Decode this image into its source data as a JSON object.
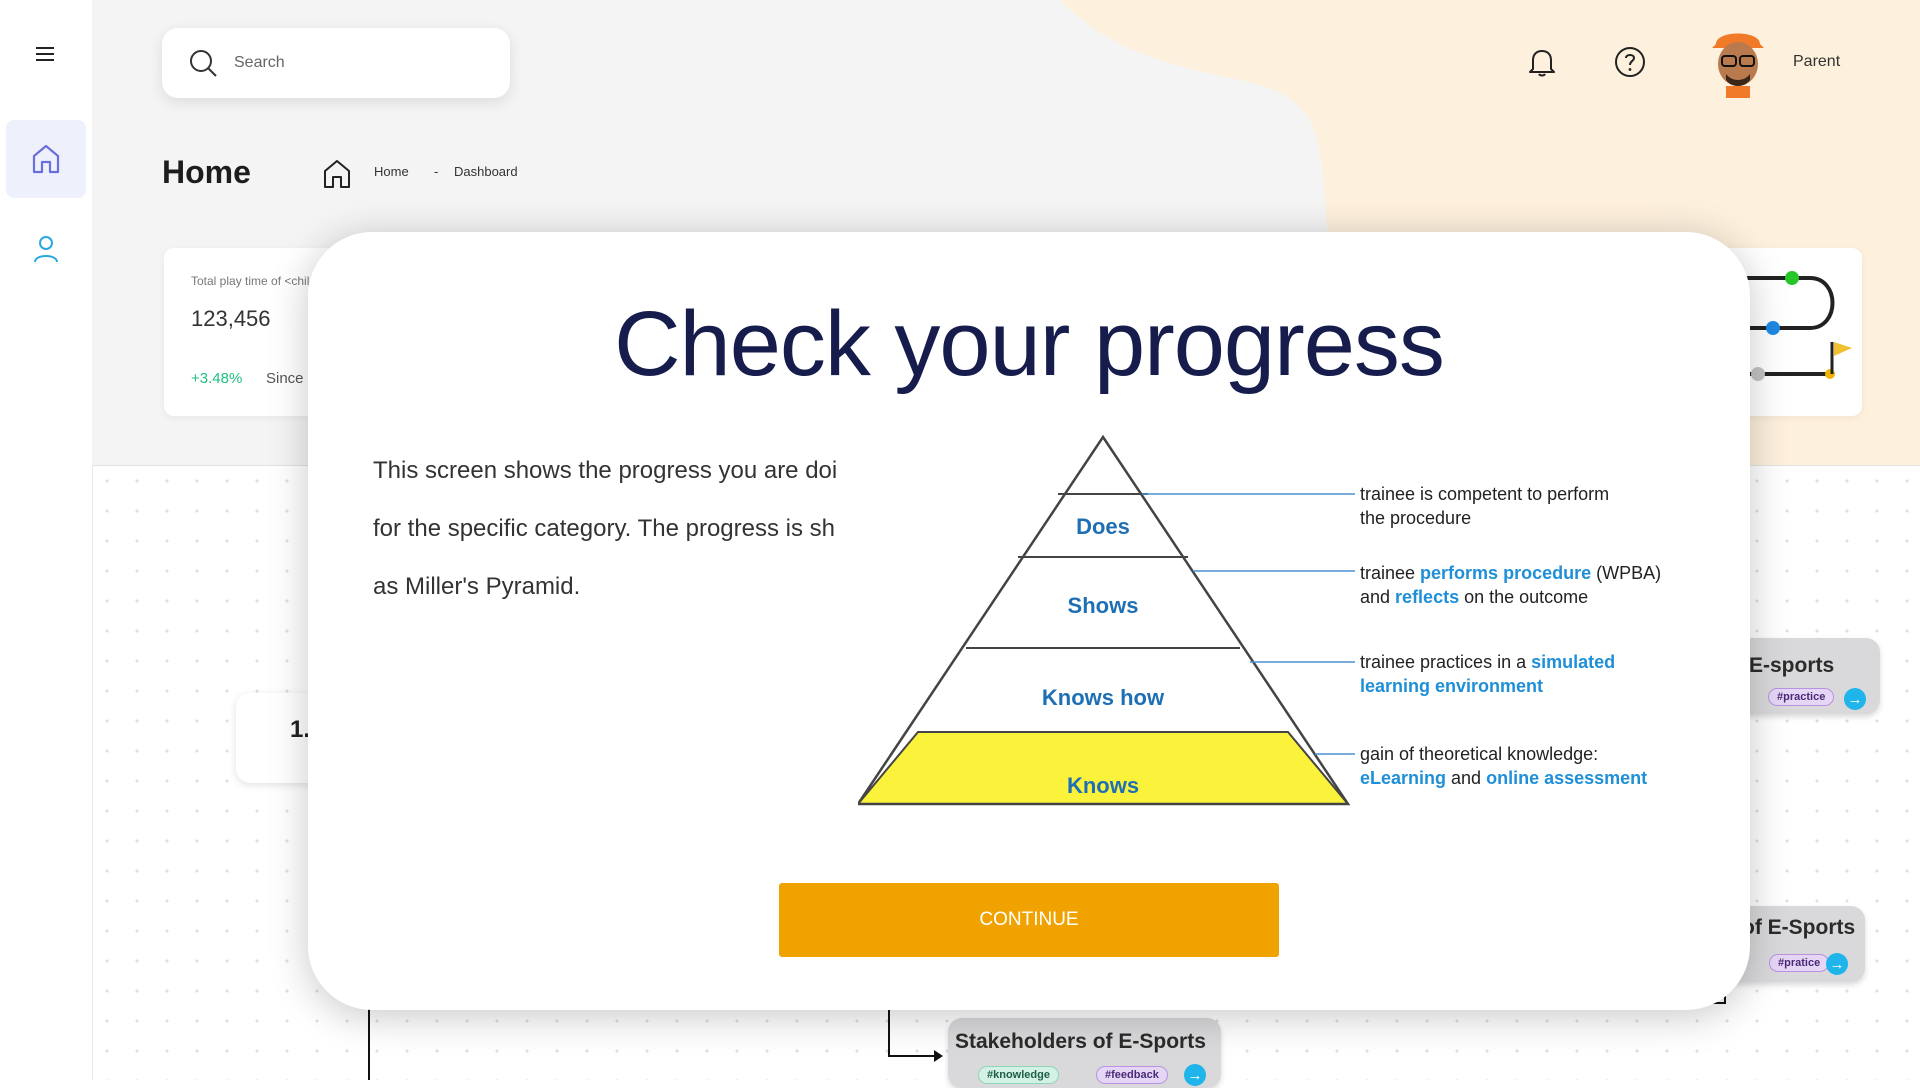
{
  "header": {
    "search_placeholder": "Search",
    "user_label": "Parent",
    "page_title": "Home",
    "breadcrumb": [
      "Home",
      "-",
      "Dashboard"
    ]
  },
  "stats": {
    "label": "Total play time of <child",
    "value": "123,456",
    "change": "+3.48%",
    "since": "Since"
  },
  "cards": {
    "step_number": "1.",
    "esports_title": "E-sports",
    "esports_tag": "#practice",
    "of_esports_title": "of E-Sports",
    "of_esports_tag": "#pratice",
    "stakeholders_title": "Stakeholders of E-Sports",
    "stakeholders_tags": [
      "#knowledge",
      "#feedback"
    ]
  },
  "modal": {
    "title": "Check your progress",
    "text_lines": [
      "This screen shows the progress you are doi",
      "for the specific category. The progress is sh",
      "as Miller's Pyramid."
    ],
    "continue_label": "CONTINUE",
    "pyramid": {
      "levels": [
        "Does",
        "Shows",
        "Knows how",
        "Knows"
      ],
      "descriptions": {
        "does": [
          "trainee is competent to perform",
          "the procedure"
        ],
        "shows": {
          "line1_prefix": "trainee ",
          "line1_highlight": "performs procedure",
          "line1_suffix": " (WPBA)",
          "line2_prefix": "and ",
          "line2_highlight": "reflects",
          "line2_suffix": " on the outcome"
        },
        "knows_how": {
          "line1_prefix": "trainee practices in a ",
          "line1_highlight": "simulated",
          "line2_highlight": "learning environment"
        },
        "knows": {
          "line1": "gain of theoretical knowledge:",
          "line2_highlight_a": "eLearning",
          "line2_mid": " and ",
          "line2_highlight_b": "online assessment"
        }
      },
      "colors": {
        "level_text": "#1f6fb5",
        "highlight": "#1f8fd8",
        "base_fill": "#fbf23c"
      }
    }
  }
}
